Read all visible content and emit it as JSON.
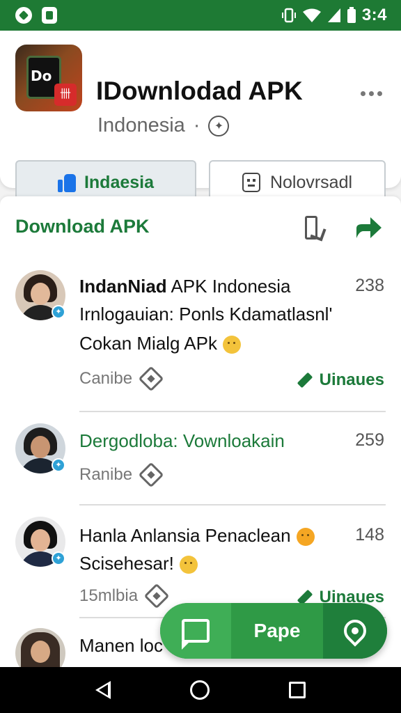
{
  "status": {
    "time": "3:4"
  },
  "header": {
    "app_title": "IDownlodad APK",
    "subtitle": "Indonesia",
    "subtitle_sep": "·",
    "icon_text": "Do",
    "icon_badge": "卌",
    "like_label": "Indaesia",
    "other_label": "Nolovrsadl"
  },
  "feed": {
    "title": "Download APK",
    "posts": [
      {
        "title_bold": "IndanNiad",
        "title_rest": " APK Indonesia",
        "line2": "Irnlogauian: Ponls Kdamatlasnl'",
        "line3": "Cokan Mialg APk",
        "count": "238",
        "meta": "Canibe",
        "update": "Uinaues"
      },
      {
        "title": "Dergodloba: Vownloakain",
        "count": "259",
        "meta": "Ranibe"
      },
      {
        "title": "Hanla Anlansia Penaclean",
        "line2": "Scisehesar!",
        "count": "148",
        "meta": "15mlbia",
        "update": "Uinaues"
      },
      {
        "title": "Manen loc"
      }
    ]
  },
  "fab": {
    "label": "Pape"
  },
  "colors": {
    "brand_green": "#1e7a34",
    "accent_blue": "#1a73e8"
  }
}
